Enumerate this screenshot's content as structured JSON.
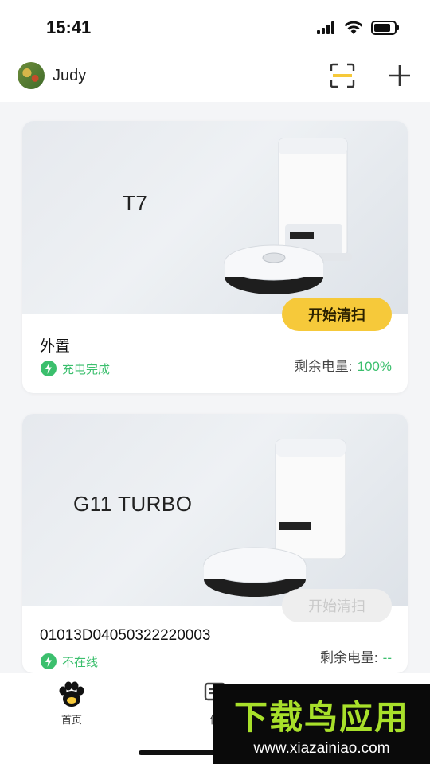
{
  "status_bar": {
    "time": "15:41"
  },
  "header": {
    "user_name": "Judy"
  },
  "devices": [
    {
      "model": "T7",
      "name": "外置",
      "status": "充电完成",
      "start_label": "开始清扫",
      "start_enabled": true,
      "battery_label": "剩余电量:",
      "battery_value": "100%"
    },
    {
      "model": "G11  TURBO",
      "name": "01013D04050322220003",
      "status": "不在线",
      "start_label": "开始清扫",
      "start_enabled": false,
      "battery_label": "剩余电量:",
      "battery_value": "--"
    }
  ],
  "tabs": [
    {
      "label": "首页",
      "icon": "paw-icon",
      "active": true
    },
    {
      "label": "信",
      "icon": "message-icon",
      "active": false
    }
  ],
  "watermark": {
    "title": "下载鸟应用",
    "url": "www.xiazainiao.com"
  },
  "colors": {
    "accent_yellow": "#f6c93a",
    "status_green": "#3bbf6d"
  }
}
